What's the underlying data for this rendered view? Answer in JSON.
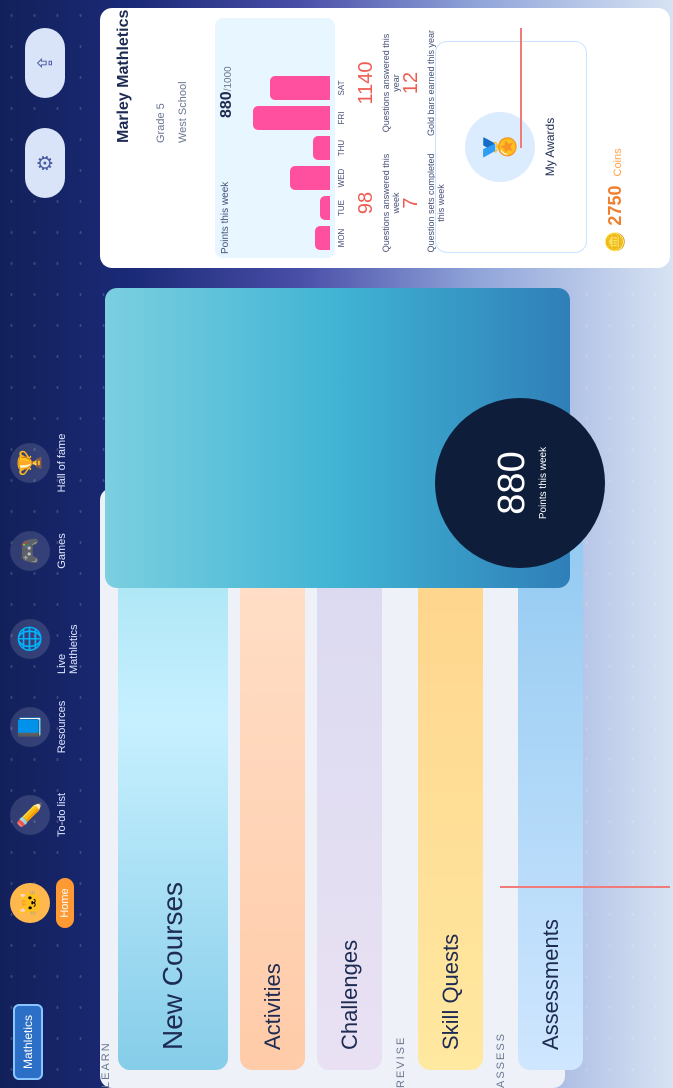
{
  "branding": {
    "logo_text": "Mathletics"
  },
  "nav": {
    "items": [
      {
        "label": "Home",
        "icon": "cat-icon",
        "active": true
      },
      {
        "label": "To-do list",
        "icon": "pencil-icon",
        "active": false
      },
      {
        "label": "Resources",
        "icon": "book-icon",
        "active": false
      },
      {
        "label": "Live Mathletics",
        "icon": "globe-icon",
        "active": false
      },
      {
        "label": "Games",
        "icon": "controller-icon",
        "active": false
      },
      {
        "label": "Hall of fame",
        "icon": "trophy-icon",
        "active": false
      }
    ]
  },
  "learn": {
    "section": "LEARN",
    "cards": [
      {
        "label": "New Courses"
      },
      {
        "label": "Activities"
      },
      {
        "label": "Challenges"
      }
    ]
  },
  "revise": {
    "section": "REVISE",
    "card": {
      "label": "Skill Quests"
    }
  },
  "assess": {
    "section": "ASSESS",
    "card": {
      "label": "Assessments"
    }
  },
  "tree": {
    "points": "880",
    "points_label": "Points this week"
  },
  "profile": {
    "name": "Marley Mathletics",
    "grade": "Grade 5",
    "school": "West School",
    "week_chart": {
      "title": "Points this week",
      "value": "880",
      "max": "/1000",
      "days": [
        "MON",
        "TUE",
        "WED",
        "THU",
        "FRI",
        "SAT"
      ],
      "values": [
        60,
        40,
        160,
        70,
        310,
        240
      ]
    },
    "stats": [
      {
        "value": "98",
        "label": "Questions answered this week"
      },
      {
        "value": "1140",
        "label": "Questions answered this year"
      },
      {
        "value": "7",
        "label": "Question sets completed this week"
      },
      {
        "value": "12",
        "label": "Gold bars earned this year"
      }
    ],
    "awards_label": "My Awards",
    "coins": {
      "value": "2750",
      "label": "Coins"
    }
  }
}
